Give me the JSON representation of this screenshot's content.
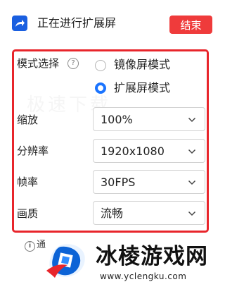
{
  "header": {
    "title": "正在进行扩展屏",
    "end_label": "结束",
    "end_color": "#ef3b3b",
    "icon": "share-arrow-icon"
  },
  "settings": {
    "mode": {
      "label": "模式选择",
      "help_icon": "question-circle-icon",
      "options": [
        {
          "label": "镜像屏模式",
          "selected": false
        },
        {
          "label": "扩展屏模式",
          "selected": true
        }
      ]
    },
    "scale": {
      "label": "缩放",
      "value": "100%"
    },
    "resolution": {
      "label": "分辨率",
      "value": "1920x1080"
    },
    "frame_rate": {
      "label": "帧率",
      "value": "30FPS"
    },
    "quality": {
      "label": "画质",
      "value": "流畅"
    }
  },
  "watermark": "极速下载",
  "footer": {
    "info_icon": "info-circle-icon",
    "info_text": "通"
  },
  "logo": {
    "name": "冰棱游戏网",
    "url": "www.yclengku.com"
  },
  "colors": {
    "accent": "#1b74ff",
    "highlight_border": "#e8252b"
  }
}
